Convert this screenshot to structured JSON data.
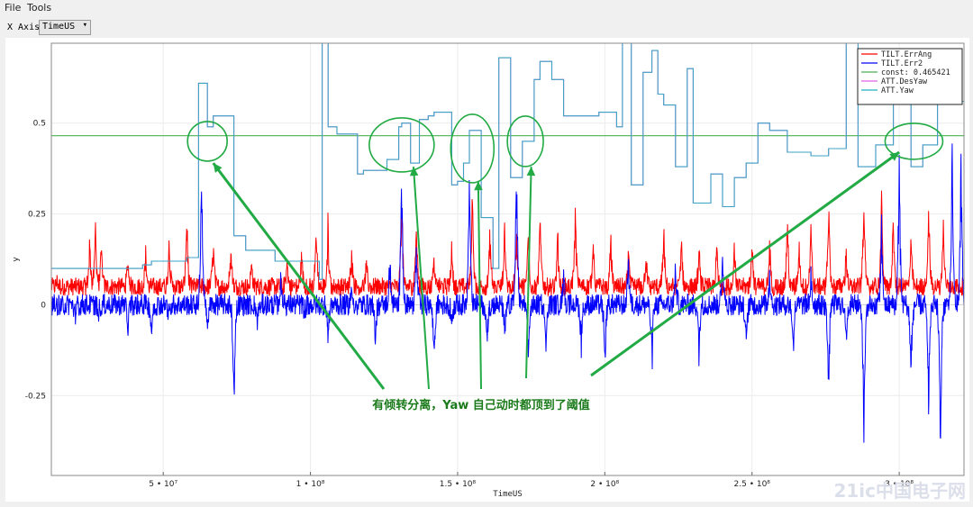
{
  "menu": {
    "file": "File",
    "tools": "Tools"
  },
  "toolbar": {
    "x_axis_label": "X Axis",
    "x_axis_value": "TimeUS"
  },
  "chart_data": {
    "type": "line",
    "xlabel": "TimeUS",
    "ylabel": "y",
    "xlim": [
      12000000,
      322000000
    ],
    "ylim": [
      -0.47,
      0.72
    ],
    "yticks": [
      -0.25,
      0,
      0.25,
      0.5
    ],
    "ytick_labels": [
      "-0.25",
      "0",
      "0.25",
      "0.5"
    ],
    "xticks": [
      50000000,
      100000000,
      150000000,
      200000000,
      250000000,
      300000000
    ],
    "xtick_labels": [
      "5 • 10⁷",
      "1 • 10⁸",
      "1.5 • 10⁸",
      "2 • 10⁸",
      "2.5 • 10⁸",
      "3 • 10⁸"
    ],
    "grid": true,
    "legend_position": "top-right",
    "series": [
      {
        "name": "TILT.ErrAng",
        "color": "#ff0000",
        "style": "noisy",
        "base": 0.02,
        "spikes": [
          [
            14000000,
            0.04
          ],
          [
            25000000,
            0.16
          ],
          [
            27000000,
            0.22
          ],
          [
            29000000,
            0.14
          ],
          [
            38000000,
            0.1
          ],
          [
            44000000,
            0.13
          ],
          [
            52000000,
            0.17
          ],
          [
            58000000,
            0.25
          ],
          [
            67000000,
            0.17
          ],
          [
            73000000,
            0.15
          ],
          [
            80000000,
            0.1
          ],
          [
            92000000,
            0.11
          ],
          [
            97000000,
            0.13
          ],
          [
            102000000,
            0.21
          ],
          [
            106000000,
            0.22
          ],
          [
            114000000,
            0.15
          ],
          [
            119000000,
            0.09
          ],
          [
            131000000,
            0.33
          ],
          [
            136000000,
            0.24
          ],
          [
            142000000,
            0.12
          ],
          [
            148000000,
            0.14
          ],
          [
            155000000,
            0.33
          ],
          [
            161000000,
            0.19
          ],
          [
            166000000,
            0.21
          ],
          [
            170000000,
            0.19
          ],
          [
            174000000,
            0.22
          ],
          [
            178000000,
            0.24
          ],
          [
            184000000,
            0.18
          ],
          [
            190000000,
            0.27
          ],
          [
            196000000,
            0.16
          ],
          [
            202000000,
            0.18
          ],
          [
            208000000,
            0.13
          ],
          [
            214000000,
            0.14
          ],
          [
            220000000,
            0.19
          ],
          [
            226000000,
            0.17
          ],
          [
            232000000,
            0.13
          ],
          [
            238000000,
            0.15
          ],
          [
            244000000,
            0.16
          ],
          [
            250000000,
            0.17
          ],
          [
            256000000,
            0.15
          ],
          [
            262000000,
            0.23
          ],
          [
            266000000,
            0.16
          ],
          [
            270000000,
            0.21
          ],
          [
            276000000,
            0.29
          ],
          [
            282000000,
            0.13
          ],
          [
            288000000,
            0.35
          ],
          [
            294000000,
            0.3
          ],
          [
            298000000,
            0.24
          ],
          [
            304000000,
            0.18
          ],
          [
            310000000,
            0.29
          ],
          [
            315000000,
            0.21
          ],
          [
            319000000,
            0.02
          ]
        ]
      },
      {
        "name": "TILT.Err2",
        "color": "#0000ff",
        "style": "noisy",
        "base": 0.0,
        "spikes": [
          [
            14000000,
            0.0
          ],
          [
            20000000,
            -0.04
          ],
          [
            28000000,
            -0.03
          ],
          [
            38000000,
            -0.07
          ],
          [
            46000000,
            -0.1
          ],
          [
            52000000,
            -0.05
          ],
          [
            63000000,
            0.47
          ],
          [
            65000000,
            -0.09
          ],
          [
            74000000,
            -0.35
          ],
          [
            82000000,
            -0.05
          ],
          [
            90000000,
            0.08
          ],
          [
            98000000,
            -0.02
          ],
          [
            106000000,
            -0.11
          ],
          [
            114000000,
            0.05
          ],
          [
            122000000,
            -0.12
          ],
          [
            127000000,
            0.15
          ],
          [
            131000000,
            0.46
          ],
          [
            136000000,
            0.18
          ],
          [
            142000000,
            -0.18
          ],
          [
            148000000,
            -0.06
          ],
          [
            154000000,
            0.47
          ],
          [
            160000000,
            -0.13
          ],
          [
            166000000,
            -0.11
          ],
          [
            170000000,
            0.47
          ],
          [
            174000000,
            -0.2
          ],
          [
            180000000,
            -0.16
          ],
          [
            186000000,
            0.12
          ],
          [
            192000000,
            -0.13
          ],
          [
            200000000,
            -0.17
          ],
          [
            208000000,
            0.16
          ],
          [
            216000000,
            -0.2
          ],
          [
            224000000,
            0.11
          ],
          [
            232000000,
            -0.17
          ],
          [
            240000000,
            0.2
          ],
          [
            248000000,
            -0.14
          ],
          [
            256000000,
            0.11
          ],
          [
            264000000,
            -0.15
          ],
          [
            270000000,
            0.08
          ],
          [
            276000000,
            -0.29
          ],
          [
            282000000,
            -0.12
          ],
          [
            288000000,
            -0.47
          ],
          [
            294000000,
            0.23
          ],
          [
            300000000,
            0.47
          ],
          [
            304000000,
            -0.25
          ],
          [
            310000000,
            -0.34
          ],
          [
            314000000,
            -0.47
          ],
          [
            318000000,
            0.47
          ],
          [
            321000000,
            0.44
          ]
        ]
      },
      {
        "name": "const: 0.465421",
        "color": "#4caf50",
        "style": "const",
        "value": 0.465421
      },
      {
        "name": "ATT.DesYaw",
        "color": "#e060e0",
        "style": "steps",
        "points": [
          [
            12000000,
            0.1
          ],
          [
            30000000,
            0.1
          ],
          [
            43000000,
            0.11
          ],
          [
            46000000,
            0.12
          ],
          [
            58000000,
            0.13
          ],
          [
            62000000,
            0.61
          ],
          [
            65000000,
            0.49
          ],
          [
            67000000,
            0.52
          ],
          [
            74000000,
            0.19
          ],
          [
            78000000,
            0.15
          ],
          [
            88000000,
            0.12
          ],
          [
            99000000,
            0.12
          ],
          [
            103000000,
            0.07
          ],
          [
            104000000,
            0.73
          ],
          [
            106000000,
            0.49
          ],
          [
            109000000,
            0.47
          ],
          [
            116000000,
            0.36
          ],
          [
            118000000,
            0.37
          ],
          [
            126000000,
            0.4
          ],
          [
            130000000,
            0.49
          ],
          [
            131000000,
            0.5
          ],
          [
            134000000,
            0.39
          ],
          [
            137000000,
            0.51
          ],
          [
            140000000,
            0.52
          ],
          [
            142000000,
            0.53
          ],
          [
            148000000,
            0.33
          ],
          [
            150000000,
            0.34
          ],
          [
            152000000,
            0.39
          ],
          [
            154000000,
            0.48
          ],
          [
            158000000,
            0.24
          ],
          [
            162000000,
            0.1
          ],
          [
            164000000,
            0.68
          ],
          [
            168000000,
            0.35
          ],
          [
            172000000,
            0.45
          ],
          [
            176000000,
            0.62
          ],
          [
            178000000,
            0.67
          ],
          [
            182000000,
            0.62
          ],
          [
            186000000,
            0.52
          ],
          [
            194000000,
            0.52
          ],
          [
            198000000,
            0.53
          ],
          [
            204000000,
            0.49
          ],
          [
            206000000,
            0.74
          ],
          [
            209000000,
            0.33
          ],
          [
            213000000,
            0.64
          ],
          [
            216000000,
            0.7
          ],
          [
            218000000,
            0.58
          ],
          [
            220000000,
            0.55
          ],
          [
            224000000,
            0.38
          ],
          [
            228000000,
            0.65
          ],
          [
            230000000,
            0.28
          ],
          [
            236000000,
            0.36
          ],
          [
            240000000,
            0.27
          ],
          [
            244000000,
            0.35
          ],
          [
            248000000,
            0.39
          ],
          [
            252000000,
            0.5
          ],
          [
            256000000,
            0.48
          ],
          [
            262000000,
            0.42
          ],
          [
            270000000,
            0.41
          ],
          [
            276000000,
            0.43
          ],
          [
            282000000,
            0.72
          ],
          [
            286000000,
            0.38
          ],
          [
            292000000,
            0.44
          ],
          [
            298000000,
            0.56
          ],
          [
            304000000,
            0.38
          ],
          [
            308000000,
            0.44
          ],
          [
            313000000,
            0.6
          ],
          [
            316000000,
            0.56
          ],
          [
            322000000,
            0.56
          ]
        ]
      },
      {
        "name": "ATT.Yaw",
        "color": "#20b0c0",
        "style": "steps",
        "points": [
          [
            12000000,
            0.1
          ],
          [
            30000000,
            0.1
          ],
          [
            43000000,
            0.11
          ],
          [
            46000000,
            0.12
          ],
          [
            58000000,
            0.13
          ],
          [
            62000000,
            0.61
          ],
          [
            65000000,
            0.49
          ],
          [
            67000000,
            0.52
          ],
          [
            74000000,
            0.19
          ],
          [
            78000000,
            0.15
          ],
          [
            88000000,
            0.12
          ],
          [
            99000000,
            0.12
          ],
          [
            103000000,
            0.07
          ],
          [
            104000000,
            0.73
          ],
          [
            106000000,
            0.49
          ],
          [
            109000000,
            0.47
          ],
          [
            116000000,
            0.36
          ],
          [
            118000000,
            0.37
          ],
          [
            126000000,
            0.4
          ],
          [
            130000000,
            0.49
          ],
          [
            131000000,
            0.5
          ],
          [
            134000000,
            0.39
          ],
          [
            137000000,
            0.51
          ],
          [
            140000000,
            0.52
          ],
          [
            142000000,
            0.53
          ],
          [
            148000000,
            0.33
          ],
          [
            150000000,
            0.34
          ],
          [
            152000000,
            0.39
          ],
          [
            154000000,
            0.48
          ],
          [
            158000000,
            0.24
          ],
          [
            162000000,
            0.1
          ],
          [
            164000000,
            0.68
          ],
          [
            168000000,
            0.35
          ],
          [
            172000000,
            0.45
          ],
          [
            176000000,
            0.62
          ],
          [
            178000000,
            0.67
          ],
          [
            182000000,
            0.62
          ],
          [
            186000000,
            0.52
          ],
          [
            194000000,
            0.52
          ],
          [
            198000000,
            0.53
          ],
          [
            204000000,
            0.49
          ],
          [
            206000000,
            0.74
          ],
          [
            209000000,
            0.33
          ],
          [
            213000000,
            0.64
          ],
          [
            216000000,
            0.7
          ],
          [
            218000000,
            0.58
          ],
          [
            220000000,
            0.55
          ],
          [
            224000000,
            0.38
          ],
          [
            228000000,
            0.65
          ],
          [
            230000000,
            0.28
          ],
          [
            236000000,
            0.36
          ],
          [
            240000000,
            0.27
          ],
          [
            244000000,
            0.35
          ],
          [
            248000000,
            0.39
          ],
          [
            252000000,
            0.5
          ],
          [
            256000000,
            0.48
          ],
          [
            262000000,
            0.42
          ],
          [
            270000000,
            0.41
          ],
          [
            276000000,
            0.43
          ],
          [
            282000000,
            0.72
          ],
          [
            286000000,
            0.38
          ],
          [
            292000000,
            0.44
          ],
          [
            298000000,
            0.56
          ],
          [
            304000000,
            0.38
          ],
          [
            308000000,
            0.44
          ],
          [
            313000000,
            0.6
          ],
          [
            316000000,
            0.56
          ],
          [
            322000000,
            0.56
          ]
        ]
      }
    ],
    "annotation": {
      "text": "有倾转分离，Yaw 自己动时都顶到了阈值",
      "color": "#1a7a1a",
      "circles": [
        [
          65000000,
          0.45
        ],
        [
          131000000,
          0.44
        ],
        [
          155000000,
          0.43
        ],
        [
          173000000,
          0.45
        ],
        [
          305000000,
          0.45
        ]
      ],
      "arrow_targets": [
        [
          67000000,
          0.39
        ],
        [
          135000000,
          0.38
        ],
        [
          157000000,
          0.34
        ],
        [
          175000000,
          0.38
        ],
        [
          300000000,
          0.42
        ]
      ]
    }
  },
  "watermark": {
    "text": "21ic中国电子网"
  }
}
